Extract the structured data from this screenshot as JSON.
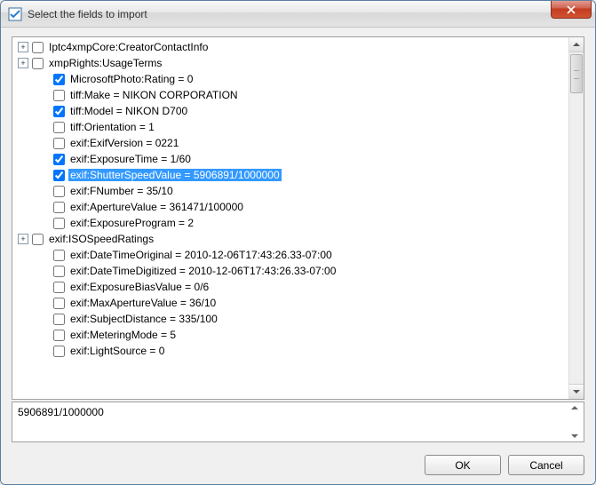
{
  "window": {
    "title": "Select the fields to import"
  },
  "tree": {
    "items": [
      {
        "depth": 0,
        "expander": "plus",
        "checked": false,
        "label": "Iptc4xmpCore:CreatorContactInfo",
        "selected": false
      },
      {
        "depth": 0,
        "expander": "plus",
        "checked": false,
        "label": "xmpRights:UsageTerms",
        "selected": false
      },
      {
        "depth": 1,
        "expander": "none",
        "checked": true,
        "label": "MicrosoftPhoto:Rating = 0",
        "selected": false
      },
      {
        "depth": 1,
        "expander": "none",
        "checked": false,
        "label": "tiff:Make = NIKON CORPORATION",
        "selected": false
      },
      {
        "depth": 1,
        "expander": "none",
        "checked": true,
        "label": "tiff:Model = NIKON D700",
        "selected": false
      },
      {
        "depth": 1,
        "expander": "none",
        "checked": false,
        "label": "tiff:Orientation = 1",
        "selected": false
      },
      {
        "depth": 1,
        "expander": "none",
        "checked": false,
        "label": "exif:ExifVersion = 0221",
        "selected": false
      },
      {
        "depth": 1,
        "expander": "none",
        "checked": true,
        "label": "exif:ExposureTime = 1/60",
        "selected": false
      },
      {
        "depth": 1,
        "expander": "none",
        "checked": true,
        "label": "exif:ShutterSpeedValue = 5906891/1000000",
        "selected": true
      },
      {
        "depth": 1,
        "expander": "none",
        "checked": false,
        "label": "exif:FNumber = 35/10",
        "selected": false
      },
      {
        "depth": 1,
        "expander": "none",
        "checked": false,
        "label": "exif:ApertureValue = 361471/100000",
        "selected": false
      },
      {
        "depth": 1,
        "expander": "none",
        "checked": false,
        "label": "exif:ExposureProgram = 2",
        "selected": false
      },
      {
        "depth": 0,
        "expander": "plus",
        "checked": false,
        "label": "exif:ISOSpeedRatings",
        "selected": false
      },
      {
        "depth": 1,
        "expander": "none",
        "checked": false,
        "label": "exif:DateTimeOriginal = 2010-12-06T17:43:26.33-07:00",
        "selected": false
      },
      {
        "depth": 1,
        "expander": "none",
        "checked": false,
        "label": "exif:DateTimeDigitized = 2010-12-06T17:43:26.33-07:00",
        "selected": false
      },
      {
        "depth": 1,
        "expander": "none",
        "checked": false,
        "label": "exif:ExposureBiasValue = 0/6",
        "selected": false
      },
      {
        "depth": 1,
        "expander": "none",
        "checked": false,
        "label": "exif:MaxApertureValue = 36/10",
        "selected": false
      },
      {
        "depth": 1,
        "expander": "none",
        "checked": false,
        "label": "exif:SubjectDistance = 335/100",
        "selected": false
      },
      {
        "depth": 1,
        "expander": "none",
        "checked": false,
        "label": "exif:MeteringMode = 5",
        "selected": false
      },
      {
        "depth": 1,
        "expander": "none",
        "checked": false,
        "label": "exif:LightSource = 0",
        "selected": false
      }
    ]
  },
  "value_preview": "5906891/1000000",
  "buttons": {
    "ok": "OK",
    "cancel": "Cancel"
  }
}
